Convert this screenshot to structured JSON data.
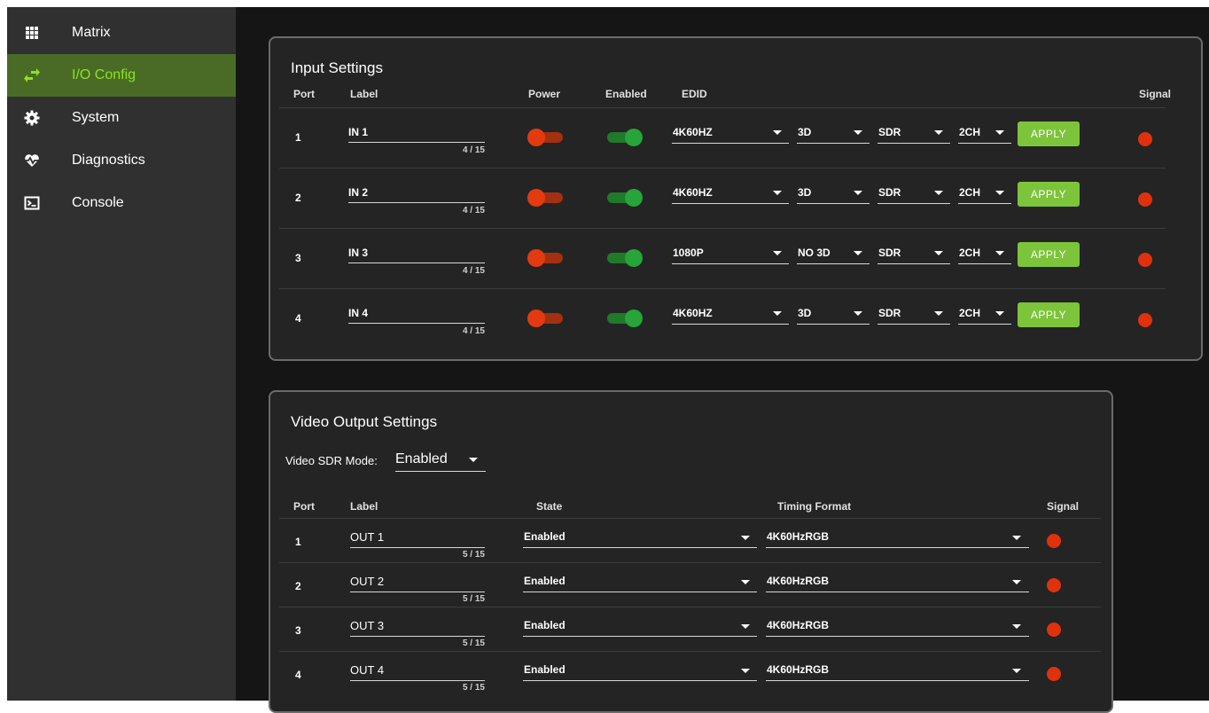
{
  "sidebar": {
    "items": [
      {
        "label": "Matrix",
        "icon": "grid-icon",
        "active": false
      },
      {
        "label": "I/O Config",
        "icon": "swap-arrows-icon",
        "active": true
      },
      {
        "label": "System",
        "icon": "gear-icon",
        "active": false
      },
      {
        "label": "Diagnostics",
        "icon": "heartbeat-icon",
        "active": false
      },
      {
        "label": "Console",
        "icon": "terminal-icon",
        "active": false
      }
    ]
  },
  "colors": {
    "active_nav_bg": "#4a6b26",
    "active_nav_text": "#8be31f",
    "apply_button": "#7cc43a",
    "signal_off": "#e0310d",
    "power_off": "#e33a10",
    "enabled_on": "#27a43a"
  },
  "input_settings": {
    "title": "Input Settings",
    "headers": {
      "port": "Port",
      "label": "Label",
      "power": "Power",
      "enabled": "Enabled",
      "edid": "EDID",
      "signal": "Signal"
    },
    "apply_label": "APPLY",
    "rows": [
      {
        "port": "1",
        "label": "IN 1",
        "counter": "4 / 15",
        "power": false,
        "enabled": true,
        "edid": "4K60HZ",
        "mode3d": "3D",
        "dynamic_range": "SDR",
        "audio": "2CH",
        "signal": false
      },
      {
        "port": "2",
        "label": "IN 2",
        "counter": "4 / 15",
        "power": false,
        "enabled": true,
        "edid": "4K60HZ",
        "mode3d": "3D",
        "dynamic_range": "SDR",
        "audio": "2CH",
        "signal": false
      },
      {
        "port": "3",
        "label": "IN 3",
        "counter": "4 / 15",
        "power": false,
        "enabled": true,
        "edid": "1080P",
        "mode3d": "NO 3D",
        "dynamic_range": "SDR",
        "audio": "2CH",
        "signal": false
      },
      {
        "port": "4",
        "label": "IN 4",
        "counter": "4 / 15",
        "power": false,
        "enabled": true,
        "edid": "4K60HZ",
        "mode3d": "3D",
        "dynamic_range": "SDR",
        "audio": "2CH",
        "signal": false
      }
    ]
  },
  "video_output": {
    "title": "Video Output Settings",
    "sdr_mode_label": "Video SDR Mode:",
    "sdr_mode_value": "Enabled",
    "headers": {
      "port": "Port",
      "label": "Label",
      "state": "State",
      "timing": "Timing Format",
      "signal": "Signal"
    },
    "rows": [
      {
        "port": "1",
        "label": "OUT 1",
        "counter": "5 / 15",
        "state": "Enabled",
        "timing": "4K60HzRGB",
        "signal": false
      },
      {
        "port": "2",
        "label": "OUT 2",
        "counter": "5 / 15",
        "state": "Enabled",
        "timing": "4K60HzRGB",
        "signal": false
      },
      {
        "port": "3",
        "label": "OUT 3",
        "counter": "5 / 15",
        "state": "Enabled",
        "timing": "4K60HzRGB",
        "signal": false
      },
      {
        "port": "4",
        "label": "OUT 4",
        "counter": "5 / 15",
        "state": "Enabled",
        "timing": "4K60HzRGB",
        "signal": false
      }
    ]
  }
}
